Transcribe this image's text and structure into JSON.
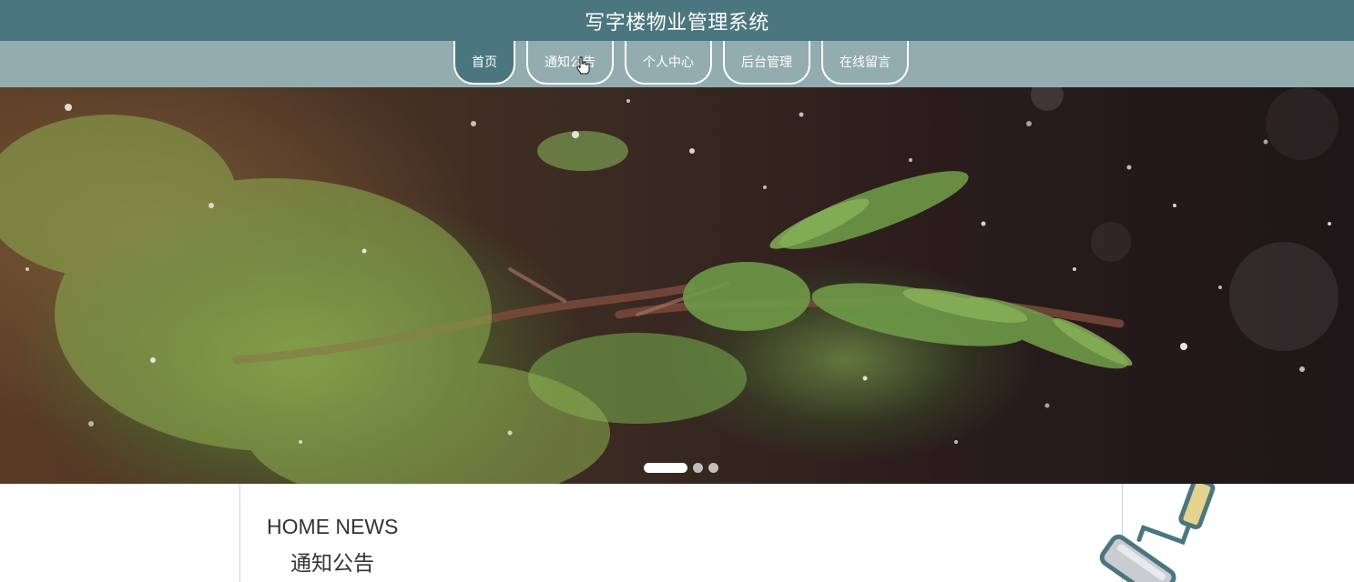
{
  "header": {
    "title": "写字楼物业管理系统"
  },
  "nav": {
    "items": [
      {
        "label": "首页"
      },
      {
        "label": "通知公告"
      },
      {
        "label": "个人中心"
      },
      {
        "label": "后台管理"
      },
      {
        "label": "在线留言"
      }
    ]
  },
  "carousel": {
    "slide_count": 3,
    "active_index": 0
  },
  "news": {
    "heading_en": "HOME NEWS",
    "heading_cn": "通知公告"
  },
  "icons": {
    "cursor": "hand-pointer-icon",
    "decoration": "paint-roller-icon"
  },
  "colors": {
    "title_bar": "#4b7680",
    "nav_bar": "#93acb0",
    "accent": "#4b7680"
  }
}
